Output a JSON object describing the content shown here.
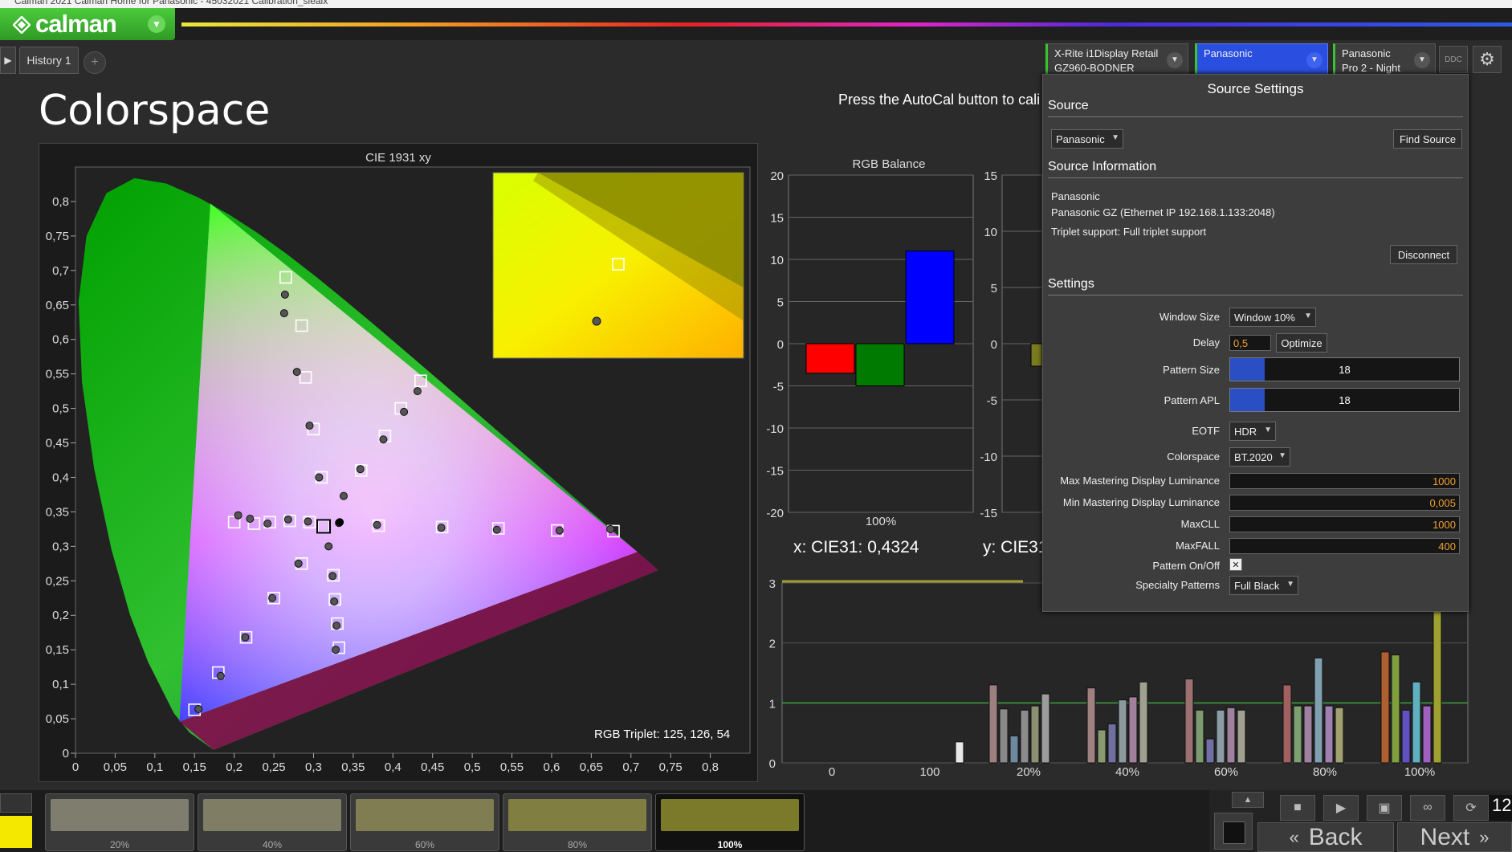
{
  "window_title": "Calman 2021 Calman Home for Panasonic - 45032021 Calibration_sieaix",
  "app": {
    "brand": "calman"
  },
  "tabs": {
    "history_label": "History 1",
    "add_label": "+"
  },
  "devices": {
    "meter": {
      "line1": "X-Rite i1Display Retail",
      "line2": "GZ960-BODNER"
    },
    "source": {
      "line1": "Panasonic",
      "line2": ""
    },
    "display": {
      "line1": "Panasonic",
      "line2": "Pro 2 - Night"
    },
    "ddc_label": "DDC"
  },
  "page": {
    "title": "Colorspace",
    "autocal_text": "Press the AutoCal button to cali"
  },
  "cie": {
    "title": "CIE 1931 xy",
    "x_ticks": [
      "0",
      "0,05",
      "0,1",
      "0,15",
      "0,2",
      "0,25",
      "0,3",
      "0,35",
      "0,4",
      "0,45",
      "0,5",
      "0,55",
      "0,6",
      "0,65",
      "0,7",
      "0,75",
      "0,8"
    ],
    "y_ticks": [
      "0",
      "0,05",
      "0,1",
      "0,15",
      "0,2",
      "0,25",
      "0,3",
      "0,35",
      "0,4",
      "0,45",
      "0,5",
      "0,55",
      "0,6",
      "0,65",
      "0,7",
      "0,75",
      "0,8"
    ],
    "triplet": "RGB Triplet: 125, 126, 54",
    "targets": [
      [
        0.265,
        0.69
      ],
      [
        0.285,
        0.62
      ],
      [
        0.29,
        0.545
      ],
      [
        0.3,
        0.47
      ],
      [
        0.31,
        0.4
      ],
      [
        0.2,
        0.335
      ],
      [
        0.225,
        0.333
      ],
      [
        0.245,
        0.335
      ],
      [
        0.27,
        0.337
      ],
      [
        0.295,
        0.335
      ],
      [
        0.3127,
        0.329
      ],
      [
        0.382,
        0.33
      ],
      [
        0.462,
        0.328
      ],
      [
        0.533,
        0.326
      ],
      [
        0.607,
        0.323
      ],
      [
        0.678,
        0.322
      ],
      [
        0.435,
        0.54
      ],
      [
        0.41,
        0.5
      ],
      [
        0.39,
        0.46
      ],
      [
        0.36,
        0.41
      ],
      [
        0.285,
        0.275
      ],
      [
        0.25,
        0.225
      ],
      [
        0.215,
        0.168
      ],
      [
        0.18,
        0.117
      ],
      [
        0.15,
        0.063
      ],
      [
        0.325,
        0.258
      ],
      [
        0.327,
        0.223
      ],
      [
        0.33,
        0.188
      ],
      [
        0.332,
        0.153
      ]
    ],
    "measured": [
      [
        0.264,
        0.665
      ],
      [
        0.263,
        0.638
      ],
      [
        0.279,
        0.553
      ],
      [
        0.295,
        0.475
      ],
      [
        0.307,
        0.4
      ],
      [
        0.205,
        0.345
      ],
      [
        0.22,
        0.34
      ],
      [
        0.242,
        0.333
      ],
      [
        0.268,
        0.339
      ],
      [
        0.293,
        0.336
      ],
      [
        0.332,
        0.334
      ],
      [
        0.38,
        0.331
      ],
      [
        0.461,
        0.327
      ],
      [
        0.531,
        0.324
      ],
      [
        0.61,
        0.323
      ],
      [
        0.674,
        0.325
      ],
      [
        0.431,
        0.525
      ],
      [
        0.414,
        0.495
      ],
      [
        0.388,
        0.455
      ],
      [
        0.359,
        0.412
      ],
      [
        0.338,
        0.373
      ],
      [
        0.281,
        0.275
      ],
      [
        0.248,
        0.225
      ],
      [
        0.214,
        0.168
      ],
      [
        0.183,
        0.112
      ],
      [
        0.155,
        0.064
      ],
      [
        0.319,
        0.3
      ],
      [
        0.324,
        0.257
      ],
      [
        0.326,
        0.22
      ],
      [
        0.329,
        0.185
      ],
      [
        0.328,
        0.15
      ]
    ],
    "current_point": [
      0.4324,
      0.409
    ]
  },
  "chart_data": [
    {
      "type": "bar",
      "title": "RGB Balance",
      "categories": [
        "100%"
      ],
      "series": [
        {
          "name": "Red",
          "values": [
            -3.5
          ]
        },
        {
          "name": "Green",
          "values": [
            -5
          ]
        },
        {
          "name": "Blue",
          "values": [
            11
          ]
        }
      ],
      "ylim": [
        -20,
        20
      ],
      "y_ticks": [
        "20",
        "15",
        "10",
        "5",
        "0",
        "-5",
        "-10",
        "-15",
        "-20"
      ],
      "colors": [
        "#ff0000",
        "#007a00",
        "#0000ff"
      ]
    },
    {
      "type": "bar",
      "title": "",
      "ylim": [
        -15,
        15
      ],
      "y_ticks": [
        "15",
        "10",
        "5",
        "0",
        "-5",
        "-10",
        "-15"
      ],
      "values": [
        -2
      ]
    },
    {
      "type": "bar",
      "title": "",
      "categories": [
        "0",
        "100",
        "20%",
        "40%",
        "60%",
        "80%",
        "100%"
      ],
      "ylim": [
        0,
        3
      ],
      "y_ticks": [
        "3",
        "2",
        "1",
        "0"
      ],
      "reference": 1,
      "groups": [
        {
          "label": "100",
          "values": [
            0.35
          ],
          "colors": [
            "#e8e8e8"
          ]
        },
        {
          "label": "20%",
          "values": [
            1.3,
            0.9,
            0.45,
            0.88,
            0.95,
            1.15
          ],
          "colors": [
            "#9c8080",
            "#888888",
            "#6e8aa0",
            "#8c8c8c",
            "#8a9070",
            "#9c9c9c"
          ]
        },
        {
          "label": "40%",
          "values": [
            1.25,
            0.55,
            0.65,
            1.05,
            1.1,
            1.35
          ],
          "colors": [
            "#a08080",
            "#8a9a70",
            "#7070a0",
            "#8c9aa0",
            "#a0809a",
            "#a0a090"
          ]
        },
        {
          "label": "60%",
          "values": [
            1.4,
            0.88,
            0.4,
            0.88,
            0.92,
            0.88
          ],
          "colors": [
            "#9c7070",
            "#7c9c70",
            "#7070a4",
            "#8c9ca4",
            "#a080a0",
            "#a0a090"
          ]
        },
        {
          "label": "80%",
          "values": [
            1.3,
            0.95,
            0.95,
            1.75,
            0.95,
            0.92
          ],
          "colors": [
            "#a06060",
            "#7ca070",
            "#a080a0",
            "#80a0b0",
            "#a080b0",
            "#a0a070"
          ]
        },
        {
          "label": "100%",
          "values": [
            1.85,
            1.8,
            0.88,
            1.35,
            0.95,
            3.05
          ],
          "colors": [
            "#b06030",
            "#80a040",
            "#6050c0",
            "#60b0c0",
            "#a060c0",
            "#a0a030"
          ]
        }
      ]
    }
  ],
  "readouts": {
    "x": "x: CIE31: 0,4324",
    "y": "y: CIE31"
  },
  "swatches": [
    {
      "label": "20%",
      "color": "#7e7d6e"
    },
    {
      "label": "40%",
      "color": "#7f7d63"
    },
    {
      "label": "60%",
      "color": "#7f7d51"
    },
    {
      "label": "80%",
      "color": "#807e41"
    },
    {
      "label": "100%",
      "color": "#7b7a2a"
    }
  ],
  "current_swatch_color": "#f5e800",
  "controls": {
    "back": "Back",
    "next": "Next",
    "counter": "12"
  },
  "source_settings": {
    "title": "Source Settings",
    "source_header": "Source",
    "source_value": "Panasonic",
    "find_source": "Find Source",
    "info_header": "Source Information",
    "info_lines": [
      "Panasonic",
      "Panasonic GZ (Ethernet IP 192.168.1.133:2048)",
      "Triplet support: Full triplet support"
    ],
    "disconnect": "Disconnect",
    "settings_header": "Settings",
    "window_size_label": "Window Size",
    "window_size_value": "Window 10%",
    "delay_label": "Delay",
    "delay_value": "0,5",
    "optimize": "Optimize",
    "pattern_size_label": "Pattern Size",
    "pattern_size_value": "18",
    "pattern_size_fill": 0.15,
    "pattern_apl_label": "Pattern APL",
    "pattern_apl_value": "18",
    "pattern_apl_fill": 0.15,
    "eotf_label": "EOTF",
    "eotf_value": "HDR",
    "colorspace_label": "Colorspace",
    "colorspace_value": "BT.2020",
    "max_mdl_label": "Max Mastering Display Luminance",
    "max_mdl_value": "1000",
    "min_mdl_label": "Min Mastering Display Luminance",
    "min_mdl_value": "0,005",
    "maxcll_label": "MaxCLL",
    "maxcll_value": "1000",
    "maxfall_label": "MaxFALL",
    "maxfall_value": "400",
    "pattern_onoff_label": "Pattern On/Off",
    "pattern_onoff_value": "✕",
    "specialty_label": "Specialty Patterns",
    "specialty_value": "Full Black"
  }
}
